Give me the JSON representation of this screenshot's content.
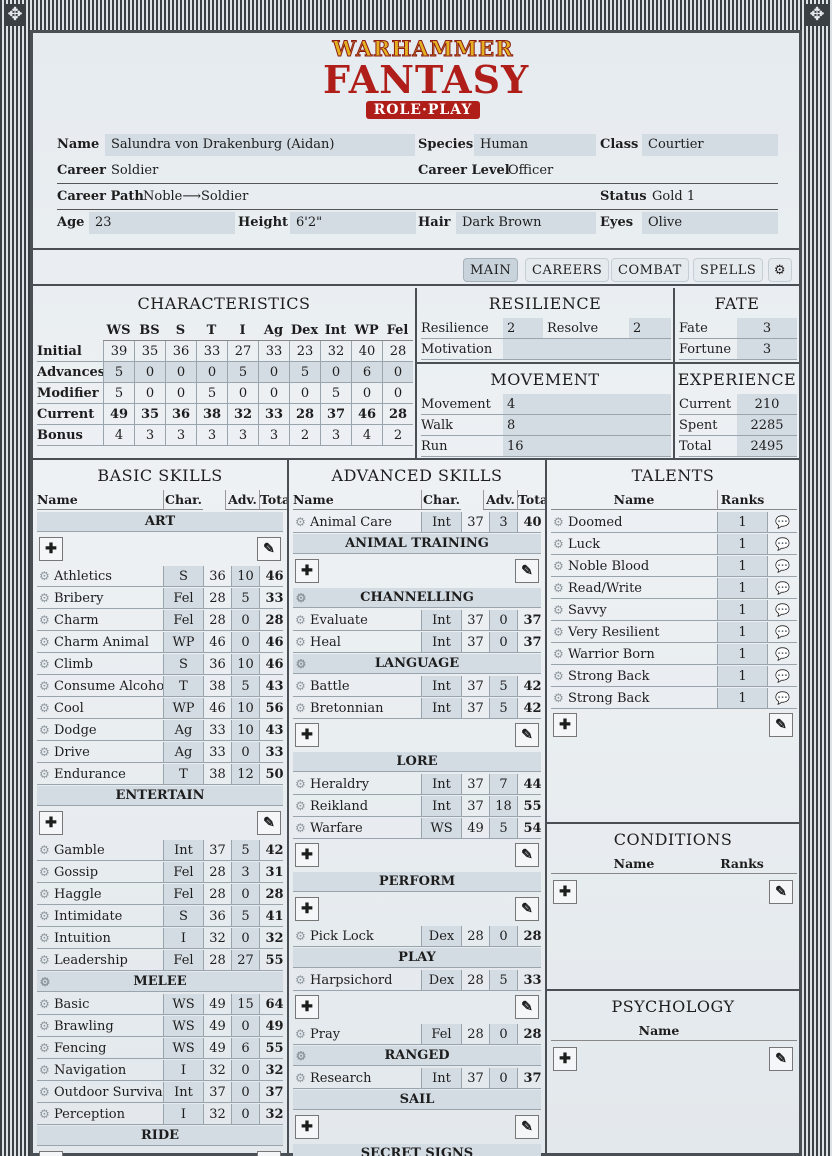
{
  "logo": {
    "line1": "WARHAMMER",
    "line2": "FANTASY",
    "line3": "ROLE·PLAY"
  },
  "info": {
    "name_label": "Name",
    "name": "Salundra von Drakenburg (Aidan)",
    "species_label": "Species",
    "species": "Human",
    "class_label": "Class",
    "class": "Courtier",
    "career_label": "Career",
    "career": "Soldier",
    "career_level_label": "Career Level",
    "career_level": "Officer",
    "career_path_label": "Career Path",
    "career_path": "Noble⟶Soldier",
    "status_label": "Status",
    "status": "Gold 1",
    "age_label": "Age",
    "age": "23",
    "height_label": "Height",
    "height": "6'2\"",
    "hair_label": "Hair",
    "hair": "Dark Brown",
    "eyes_label": "Eyes",
    "eyes": "Olive"
  },
  "tabs": [
    "MAIN",
    "CAREERS",
    "COMBAT",
    "SPELLS"
  ],
  "characteristics": {
    "title": "CHARACTERISTICS",
    "cols": [
      "WS",
      "BS",
      "S",
      "T",
      "I",
      "Ag",
      "Dex",
      "Int",
      "WP",
      "Fel"
    ],
    "rows": [
      {
        "label": "Initial",
        "vals": [
          "39",
          "35",
          "36",
          "33",
          "27",
          "33",
          "23",
          "32",
          "40",
          "28"
        ]
      },
      {
        "label": "Advances",
        "vals": [
          "5",
          "0",
          "0",
          "0",
          "5",
          "0",
          "5",
          "0",
          "6",
          "0"
        ]
      },
      {
        "label": "Modifier",
        "vals": [
          "5",
          "0",
          "0",
          "5",
          "0",
          "0",
          "0",
          "5",
          "0",
          "0"
        ]
      },
      {
        "label": "Current",
        "vals": [
          "49",
          "35",
          "36",
          "38",
          "32",
          "33",
          "28",
          "37",
          "46",
          "28"
        ]
      },
      {
        "label": "Bonus",
        "vals": [
          "4",
          "3",
          "3",
          "3",
          "3",
          "3",
          "2",
          "3",
          "4",
          "2"
        ]
      }
    ]
  },
  "resilience": {
    "title": "RESILIENCE",
    "resilience_label": "Resilience",
    "resilience": "2",
    "resolve_label": "Resolve",
    "resolve": "2",
    "motivation_label": "Motivation",
    "motivation": ""
  },
  "fate": {
    "title": "FATE",
    "fate_label": "Fate",
    "fate": "3",
    "fortune_label": "Fortune",
    "fortune": "3"
  },
  "movement": {
    "title": "MOVEMENT",
    "movement_label": "Movement",
    "movement": "4",
    "walk_label": "Walk",
    "walk": "8",
    "run_label": "Run",
    "run": "16"
  },
  "experience": {
    "title": "EXPERIENCE",
    "current_label": "Current",
    "current": "210",
    "spent_label": "Spent",
    "spent": "2285",
    "total_label": "Total",
    "total": "2495"
  },
  "skill_headers": {
    "name": "Name",
    "char": "Char.",
    "adv": "Adv.",
    "total": "Total"
  },
  "basic": {
    "title": "BASIC SKILLS",
    "items": [
      {
        "t": "sect",
        "name": "ART"
      },
      {
        "t": "btns"
      },
      {
        "t": "skill",
        "name": "Athletics",
        "c": "S",
        "v": "36",
        "a": "10",
        "tot": "46"
      },
      {
        "t": "skill",
        "name": "Bribery",
        "c": "Fel",
        "v": "28",
        "a": "5",
        "tot": "33"
      },
      {
        "t": "skill",
        "name": "Charm",
        "c": "Fel",
        "v": "28",
        "a": "0",
        "tot": "28"
      },
      {
        "t": "skill",
        "name": "Charm Animal",
        "c": "WP",
        "v": "46",
        "a": "0",
        "tot": "46"
      },
      {
        "t": "skill",
        "name": "Climb",
        "c": "S",
        "v": "36",
        "a": "10",
        "tot": "46"
      },
      {
        "t": "skill",
        "name": "Consume Alcohol",
        "c": "T",
        "v": "38",
        "a": "5",
        "tot": "43"
      },
      {
        "t": "skill",
        "name": "Cool",
        "c": "WP",
        "v": "46",
        "a": "10",
        "tot": "56"
      },
      {
        "t": "skill",
        "name": "Dodge",
        "c": "Ag",
        "v": "33",
        "a": "10",
        "tot": "43"
      },
      {
        "t": "skill",
        "name": "Drive",
        "c": "Ag",
        "v": "33",
        "a": "0",
        "tot": "33"
      },
      {
        "t": "skill",
        "name": "Endurance",
        "c": "T",
        "v": "38",
        "a": "12",
        "tot": "50"
      },
      {
        "t": "sect",
        "name": "ENTERTAIN"
      },
      {
        "t": "btns"
      },
      {
        "t": "skill",
        "name": "Gamble",
        "c": "Int",
        "v": "37",
        "a": "5",
        "tot": "42"
      },
      {
        "t": "skill",
        "name": "Gossip",
        "c": "Fel",
        "v": "28",
        "a": "3",
        "tot": "31"
      },
      {
        "t": "skill",
        "name": "Haggle",
        "c": "Fel",
        "v": "28",
        "a": "0",
        "tot": "28"
      },
      {
        "t": "skill",
        "name": "Intimidate",
        "c": "S",
        "v": "36",
        "a": "5",
        "tot": "41"
      },
      {
        "t": "skill",
        "name": "Intuition",
        "c": "I",
        "v": "32",
        "a": "0",
        "tot": "32"
      },
      {
        "t": "skill",
        "name": "Leadership",
        "c": "Fel",
        "v": "28",
        "a": "27",
        "tot": "55"
      },
      {
        "t": "gsect",
        "name": "MELEE"
      },
      {
        "t": "skill",
        "name": "Basic",
        "c": "WS",
        "v": "49",
        "a": "15",
        "tot": "64"
      },
      {
        "t": "skill",
        "name": "Brawling",
        "c": "WS",
        "v": "49",
        "a": "0",
        "tot": "49"
      },
      {
        "t": "skill",
        "name": "Fencing",
        "c": "WS",
        "v": "49",
        "a": "6",
        "tot": "55"
      },
      {
        "t": "skill",
        "name": "Navigation",
        "c": "I",
        "v": "32",
        "a": "0",
        "tot": "32"
      },
      {
        "t": "skill",
        "name": "Outdoor Survival",
        "c": "Int",
        "v": "37",
        "a": "0",
        "tot": "37"
      },
      {
        "t": "skill",
        "name": "Perception",
        "c": "I",
        "v": "32",
        "a": "0",
        "tot": "32"
      },
      {
        "t": "sect",
        "name": "RIDE"
      },
      {
        "t": "btns"
      }
    ]
  },
  "advanced": {
    "title": "ADVANCED SKILLS",
    "items": [
      {
        "t": "skill",
        "name": "Animal Care",
        "c": "Int",
        "v": "37",
        "a": "3",
        "tot": "40"
      },
      {
        "t": "sect",
        "name": "ANIMAL TRAINING"
      },
      {
        "t": "btns"
      },
      {
        "t": "gsect",
        "name": "CHANNELLING"
      },
      {
        "t": "skill",
        "name": "Evaluate",
        "c": "Int",
        "v": "37",
        "a": "0",
        "tot": "37"
      },
      {
        "t": "skill",
        "name": "Heal",
        "c": "Int",
        "v": "37",
        "a": "0",
        "tot": "37"
      },
      {
        "t": "gsect",
        "name": "LANGUAGE"
      },
      {
        "t": "skill",
        "name": "Battle",
        "c": "Int",
        "v": "37",
        "a": "5",
        "tot": "42"
      },
      {
        "t": "skill",
        "name": "Bretonnian",
        "c": "Int",
        "v": "37",
        "a": "5",
        "tot": "42"
      },
      {
        "t": "btns"
      },
      {
        "t": "sect",
        "name": "LORE"
      },
      {
        "t": "skill",
        "name": "Heraldry",
        "c": "Int",
        "v": "37",
        "a": "7",
        "tot": "44"
      },
      {
        "t": "skill",
        "name": "Reikland",
        "c": "Int",
        "v": "37",
        "a": "18",
        "tot": "55"
      },
      {
        "t": "skill",
        "name": "Warfare",
        "c": "WS",
        "v": "49",
        "a": "5",
        "tot": "54"
      },
      {
        "t": "btns"
      },
      {
        "t": "sect",
        "name": "PERFORM"
      },
      {
        "t": "btns"
      },
      {
        "t": "skill",
        "name": "Pick Lock",
        "c": "Dex",
        "v": "28",
        "a": "0",
        "tot": "28"
      },
      {
        "t": "sect",
        "name": "PLAY"
      },
      {
        "t": "skill",
        "name": "Harpsichord",
        "c": "Dex",
        "v": "28",
        "a": "5",
        "tot": "33"
      },
      {
        "t": "btns"
      },
      {
        "t": "skill",
        "name": "Pray",
        "c": "Fel",
        "v": "28",
        "a": "0",
        "tot": "28"
      },
      {
        "t": "gsect",
        "name": "RANGED"
      },
      {
        "t": "skill",
        "name": "Research",
        "c": "Int",
        "v": "37",
        "a": "0",
        "tot": "37"
      },
      {
        "t": "sect",
        "name": "SAIL"
      },
      {
        "t": "btns"
      },
      {
        "t": "sect",
        "name": "SECRET SIGNS"
      }
    ]
  },
  "talents": {
    "title": "TALENTS",
    "name_header": "Name",
    "ranks_header": "Ranks",
    "items": [
      {
        "name": "Doomed",
        "rank": "1"
      },
      {
        "name": "Luck",
        "rank": "1"
      },
      {
        "name": "Noble Blood",
        "rank": "1"
      },
      {
        "name": "Read/Write",
        "rank": "1"
      },
      {
        "name": "Savvy",
        "rank": "1"
      },
      {
        "name": "Very Resilient",
        "rank": "1"
      },
      {
        "name": "Warrior Born",
        "rank": "1"
      },
      {
        "name": "Strong Back",
        "rank": "1"
      },
      {
        "name": "Strong Back",
        "rank": "1"
      }
    ]
  },
  "conditions": {
    "title": "CONDITIONS",
    "name_header": "Name",
    "ranks_header": "Ranks"
  },
  "psychology": {
    "title": "PSYCHOLOGY",
    "name_header": "Name"
  },
  "icons": {
    "gear": "gear-icon",
    "add": "plus-icon",
    "edit": "pencil-icon",
    "comment": "speech-bubble-icon",
    "settings": "settings-gear-icon"
  },
  "colors": {
    "brand_red": "#b01e1a",
    "brand_gold": "#e3b021",
    "field_bg": "#d4dce3",
    "frame_dark": "#3a3f44"
  }
}
